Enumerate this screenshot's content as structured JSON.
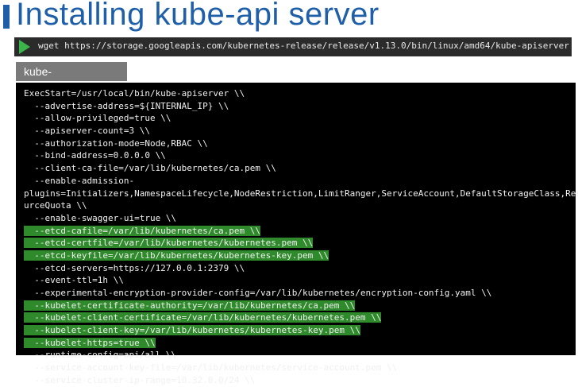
{
  "header": {
    "title": "Installing kube-api server"
  },
  "command": {
    "icon": "play-icon",
    "text": "wget https://storage.googleapis.com/kubernetes-release/release/v1.13.0/bin/linux/amd64/kube-apiserver"
  },
  "file": {
    "label": "kube-apiserver.service"
  },
  "colors": {
    "title": "#1f5fa8",
    "highlight": "#2f8a2b",
    "code_bg": "#000000"
  },
  "code": {
    "lines": [
      {
        "text": "ExecStart=/usr/local/bin/kube-apiserver \\\\",
        "highlight": false
      },
      {
        "text": "  --advertise-address=${INTERNAL_IP} \\\\",
        "highlight": false
      },
      {
        "text": "  --allow-privileged=true \\\\",
        "highlight": false
      },
      {
        "text": "  --apiserver-count=3 \\\\",
        "highlight": false
      },
      {
        "text": "  --authorization-mode=Node,RBAC \\\\",
        "highlight": false
      },
      {
        "text": "  --bind-address=0.0.0.0 \\\\",
        "highlight": false
      },
      {
        "text": "  --client-ca-file=/var/lib/kubernetes/ca.pem \\\\",
        "highlight": false
      },
      {
        "text": "  --enable-admission-",
        "highlight": false
      },
      {
        "text": "plugins=Initializers,NamespaceLifecycle,NodeRestriction,LimitRanger,ServiceAccount,DefaultStorageClass,Reso",
        "highlight": false
      },
      {
        "text": "urceQuota \\\\",
        "highlight": false
      },
      {
        "text": "  --enable-swagger-ui=true \\\\",
        "highlight": false
      },
      {
        "text": "  --etcd-cafile=/var/lib/kubernetes/ca.pem \\\\",
        "highlight": true
      },
      {
        "text": "  --etcd-certfile=/var/lib/kubernetes/kubernetes.pem \\\\",
        "highlight": true
      },
      {
        "text": "  --etcd-keyfile=/var/lib/kubernetes/kubernetes-key.pem \\\\",
        "highlight": true
      },
      {
        "text": "  --etcd-servers=https://127.0.0.1:2379 \\\\",
        "highlight": false
      },
      {
        "text": "  --event-ttl=1h \\\\",
        "highlight": false
      },
      {
        "text": "  --experimental-encryption-provider-config=/var/lib/kubernetes/encryption-config.yaml \\\\",
        "highlight": false
      },
      {
        "text": "  --kubelet-certificate-authority=/var/lib/kubernetes/ca.pem \\\\",
        "highlight": true
      },
      {
        "text": "  --kubelet-client-certificate=/var/lib/kubernetes/kubernetes.pem \\\\",
        "highlight": true
      },
      {
        "text": "  --kubelet-client-key=/var/lib/kubernetes/kubernetes-key.pem \\\\",
        "highlight": true
      },
      {
        "text": "  --kubelet-https=true \\\\",
        "highlight": true
      },
      {
        "text": "  --runtime-config=api/all \\\\",
        "highlight": false
      },
      {
        "text": "  --service-account-key-file=/var/lib/kubernetes/service-account.pem \\\\",
        "highlight": false
      },
      {
        "text": "  --service-cluster-ip-range=10.32.0.0/24 \\\\",
        "highlight": false
      }
    ]
  }
}
